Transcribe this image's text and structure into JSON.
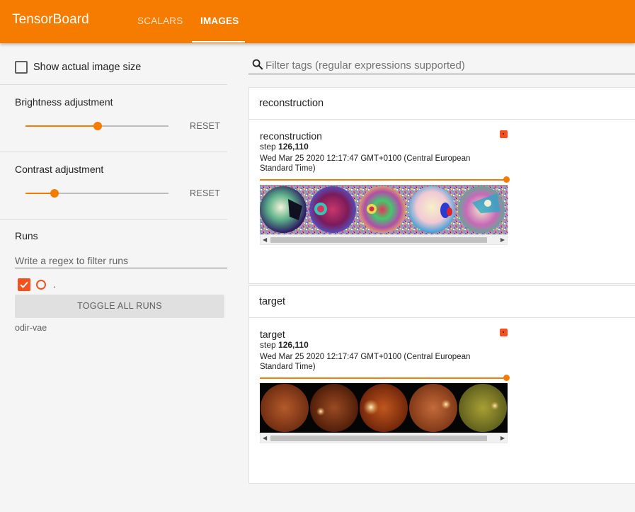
{
  "header": {
    "brand": "TensorBoard",
    "tabs": [
      {
        "label": "SCALARS",
        "active": false
      },
      {
        "label": "IMAGES",
        "active": true
      }
    ],
    "accent": "#f57c00"
  },
  "sidebar": {
    "show_actual_size": {
      "label": "Show actual image size",
      "checked": false
    },
    "brightness": {
      "label": "Brightness adjustment",
      "reset_label": "RESET",
      "value_fraction": 0.5
    },
    "contrast": {
      "label": "Contrast adjustment",
      "reset_label": "RESET",
      "value_fraction": 0.2
    },
    "runs": {
      "label": "Runs",
      "filter_placeholder": "Write a regex to filter runs",
      "items": [
        {
          "name": ".",
          "checked": true,
          "color": "#f4511e"
        }
      ],
      "toggle_label": "TOGGLE ALL RUNS",
      "footer_label": "odir-vae"
    }
  },
  "main": {
    "filter_placeholder": "Filter tags (regular expressions supported)",
    "categories": [
      {
        "title": "reconstruction",
        "card": {
          "tag": "reconstruction",
          "step_label": "step",
          "step": "126,110",
          "timestamp": "Wed Mar 25 2020 12:17:47 GMT+0100 (Central European Standard Time)",
          "image_kind": "noisy-reconstruction-strip",
          "step_position_fraction": 1.0
        }
      },
      {
        "title": "target",
        "card": {
          "tag": "target",
          "step_label": "step",
          "step": "126,110",
          "timestamp": "Wed Mar 25 2020 12:17:47 GMT+0100 (Central European Standard Time)",
          "image_kind": "fundus-photo-strip",
          "step_position_fraction": 1.0
        }
      }
    ]
  }
}
